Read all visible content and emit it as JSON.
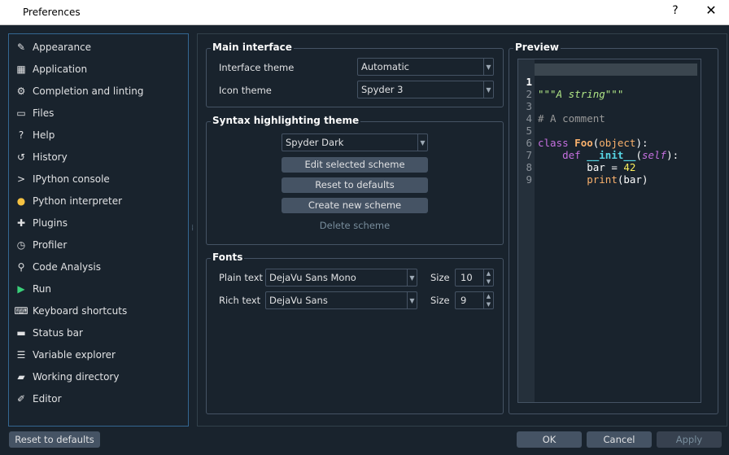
{
  "window": {
    "title": "Preferences",
    "help_label": "?",
    "close_label": "✕"
  },
  "sidebar": {
    "items": [
      {
        "label": "Appearance",
        "icon": "✎",
        "icon_name": "brush-icon"
      },
      {
        "label": "Application",
        "icon": "▦",
        "icon_name": "application-icon"
      },
      {
        "label": "Completion and linting",
        "icon": "⚙",
        "icon_name": "completion-icon"
      },
      {
        "label": "Files",
        "icon": "▭",
        "icon_name": "files-icon"
      },
      {
        "label": "Help",
        "icon": "?",
        "icon_name": "help-icon"
      },
      {
        "label": "History",
        "icon": "↺",
        "icon_name": "history-icon"
      },
      {
        "label": "IPython console",
        "icon": ">",
        "icon_name": "ipython-console-icon"
      },
      {
        "label": "Python interpreter",
        "icon": "●",
        "icon_name": "python-icon"
      },
      {
        "label": "Plugins",
        "icon": "✚",
        "icon_name": "plugins-icon"
      },
      {
        "label": "Profiler",
        "icon": "◷",
        "icon_name": "profiler-icon"
      },
      {
        "label": "Code Analysis",
        "icon": "⚲",
        "icon_name": "code-analysis-icon"
      },
      {
        "label": "Run",
        "icon": "▶",
        "icon_name": "run-icon"
      },
      {
        "label": "Keyboard shortcuts",
        "icon": "⌨",
        "icon_name": "keyboard-icon"
      },
      {
        "label": "Status bar",
        "icon": "▬",
        "icon_name": "status-bar-icon"
      },
      {
        "label": "Variable explorer",
        "icon": "☰",
        "icon_name": "variable-explorer-icon"
      },
      {
        "label": "Working directory",
        "icon": "▰",
        "icon_name": "folder-icon"
      },
      {
        "label": "Editor",
        "icon": "✐",
        "icon_name": "editor-icon"
      }
    ]
  },
  "main_interface": {
    "title": "Main interface",
    "interface_theme_label": "Interface theme",
    "interface_theme_value": "Automatic",
    "icon_theme_label": "Icon theme",
    "icon_theme_value": "Spyder 3"
  },
  "syntax": {
    "title": "Syntax highlighting theme",
    "scheme_value": "Spyder Dark",
    "edit_label": "Edit selected scheme",
    "reset_label": "Reset to defaults",
    "create_label": "Create new scheme",
    "delete_label": "Delete scheme"
  },
  "fonts": {
    "title": "Fonts",
    "plain_label": "Plain text",
    "plain_value": "DejaVu Sans Mono",
    "plain_size_label": "Size",
    "plain_size": "10",
    "rich_label": "Rich text",
    "rich_value": "DejaVu Sans",
    "rich_size_label": "Size",
    "rich_size": "9"
  },
  "preview": {
    "title": "Preview",
    "line_numbers": [
      "1",
      "2",
      "3",
      "4",
      "5",
      "6",
      "7",
      "8",
      "9"
    ],
    "code": {
      "l1_string": "\"\"\"A string\"\"\"",
      "l3_comment": "# A comment",
      "l5_class": "class",
      "l5_name": "Foo",
      "l5_open": "(",
      "l5_base": "object",
      "l5_close": "):",
      "l6_def": "def",
      "l6_name": "__init__",
      "l6_open": "(",
      "l6_self": "self",
      "l6_close": "):",
      "l7_var": "bar = ",
      "l7_num": "42",
      "l8_call": "print(bar)"
    },
    "colors": {
      "keyword": "#c670e0",
      "class_name": "#fab16c",
      "builtin": "#fab16c",
      "string": "#b0e686",
      "comment": "#999999",
      "number": "#faed5c",
      "self": "#c670e0"
    }
  },
  "footer": {
    "reset_label": "Reset to defaults",
    "ok_label": "OK",
    "cancel_label": "Cancel",
    "apply_label": "Apply"
  }
}
